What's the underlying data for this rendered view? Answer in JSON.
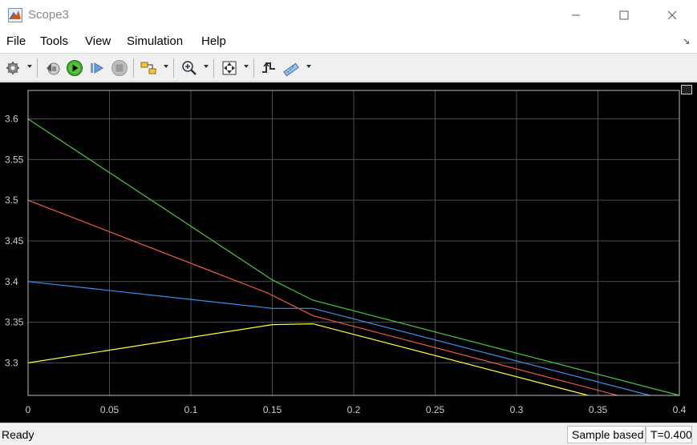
{
  "window": {
    "title": "Scope3"
  },
  "menu": {
    "items": [
      "File",
      "Tools",
      "View",
      "Simulation",
      "Help"
    ]
  },
  "toolbar": {
    "icons": [
      "settings-icon",
      "step-back-icon",
      "run-icon",
      "step-forward-icon",
      "stop-icon",
      "highlight-block-icon",
      "zoom-icon",
      "autoscale-icon",
      "triggers-icon",
      "measurements-icon"
    ]
  },
  "status": {
    "text": "Ready",
    "sample_mode": "Sample based",
    "time": "T=0.400"
  },
  "colors": {
    "background": "#000000",
    "grid": "#4d4d4d",
    "axis_text": "#cccccc",
    "series": [
      "#ffff33",
      "#3b8ff0",
      "#f05a40",
      "#4cc43c"
    ]
  },
  "chart_data": {
    "type": "line",
    "title": "",
    "xlabel": "",
    "ylabel": "",
    "xlim": [
      0,
      0.4
    ],
    "ylim": [
      3.26,
      3.635
    ],
    "grid": true,
    "xticks": [
      0,
      0.05,
      0.1,
      0.15,
      0.2,
      0.25,
      0.3,
      0.35,
      0.4
    ],
    "xtick_labels": [
      "0",
      "0.05",
      "0.1",
      "0.15",
      "0.2",
      "0.25",
      "0.3",
      "0.35",
      "0.4"
    ],
    "yticks": [
      3.3,
      3.35,
      3.4,
      3.45,
      3.5,
      3.55,
      3.6
    ],
    "ytick_labels": [
      "3.3",
      "3.35",
      "3.4",
      "3.45",
      "3.5",
      "3.55",
      "3.6"
    ],
    "series": [
      {
        "x": [
          0,
          0.15,
          0.175,
          0.344
        ],
        "y": [
          3.3,
          3.347,
          3.348,
          3.26
        ]
      },
      {
        "x": [
          0,
          0.15,
          0.175,
          0.382
        ],
        "y": [
          3.4,
          3.367,
          3.367,
          3.26
        ]
      },
      {
        "x": [
          0,
          0.147,
          0.175,
          0.362
        ],
        "y": [
          3.5,
          3.386,
          3.358,
          3.26
        ]
      },
      {
        "x": [
          0,
          0.15,
          0.175,
          0.4
        ],
        "y": [
          3.6,
          3.402,
          3.377,
          3.26
        ]
      }
    ]
  }
}
